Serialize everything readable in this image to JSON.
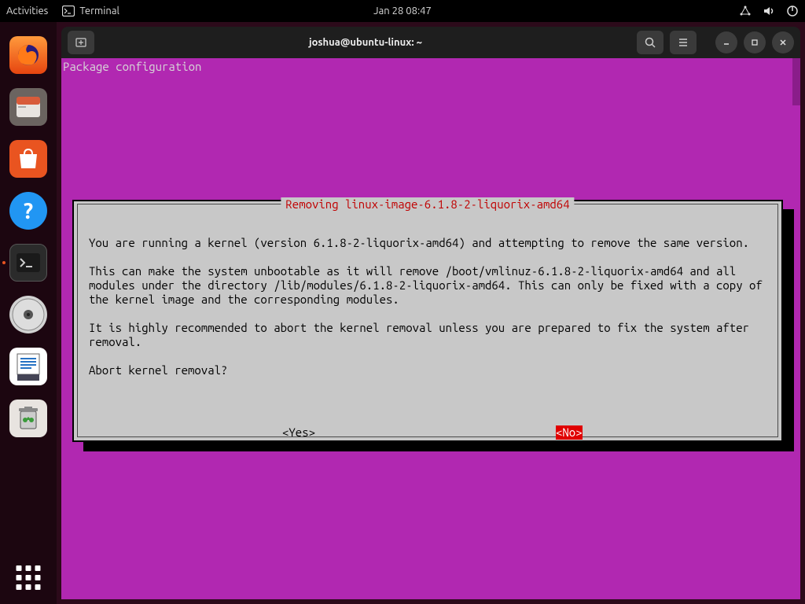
{
  "topbar": {
    "activities": "Activities",
    "app_name": "Terminal",
    "datetime": "Jan 28  08:47"
  },
  "window": {
    "title": "joshua@ubuntu-linux: ~"
  },
  "terminal": {
    "header": "Package configuration",
    "dialog_title": " Removing linux-image-6.1.8-2-liquorix-amd64 ",
    "body_line1": "You are running a kernel (version 6.1.8-2-liquorix-amd64) and attempting to remove the same version.",
    "body_line2": "This can make the system unbootable as it will remove /boot/vmlinuz-6.1.8-2-liquorix-amd64 and all modules under the directory /lib/modules/6.1.8-2-liquorix-amd64. This can only be fixed with a copy of the kernel image and the corresponding modules.",
    "body_line3": "It is highly recommended to abort the kernel removal unless you are prepared to fix the system after removal.",
    "body_line4": "Abort kernel removal?",
    "yes_label": "<Yes>",
    "no_label": "<No>"
  }
}
